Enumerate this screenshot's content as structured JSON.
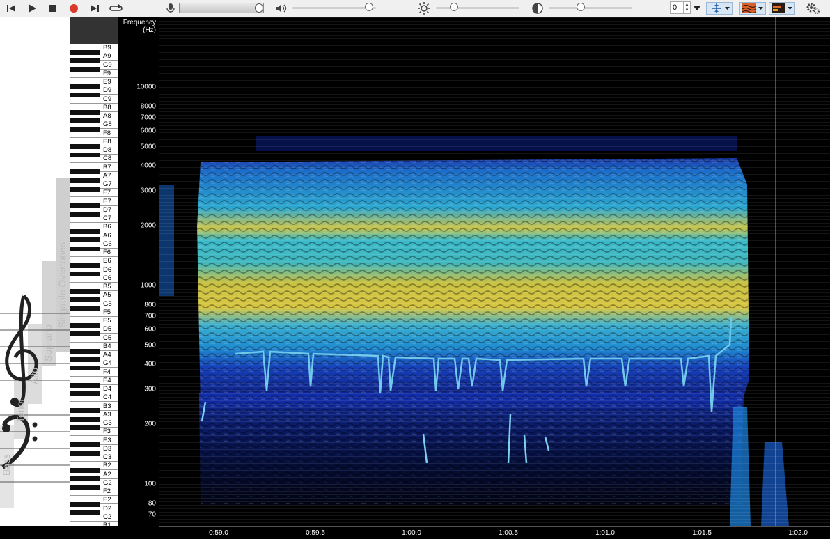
{
  "toolbar": {
    "spin_value": "0"
  },
  "voices": {
    "bass": "Bass",
    "tenor": "Tenor",
    "alto": "Alto",
    "soprano": "Soprano",
    "overtones": "Singable Overtones"
  },
  "freq_axis": {
    "title_line1": "Frequency",
    "title_line2": "(Hz)",
    "ticks": [
      "10000",
      "8000",
      "7000",
      "6000",
      "5000",
      "4000",
      "3000",
      "2000",
      "1000",
      "800",
      "700",
      "600",
      "500",
      "400",
      "300",
      "200",
      "100",
      "80",
      "70"
    ]
  },
  "time_axis": {
    "ticks": [
      "0:59.0",
      "0:59.5",
      "1:00.0",
      "1:00.5",
      "1:01.0",
      "1:01.5",
      "1:02.0"
    ]
  },
  "notes": [
    "B9",
    "A9",
    "G9",
    "F9",
    "E9",
    "D9",
    "C9",
    "B8",
    "A8",
    "G8",
    "F8",
    "E8",
    "D8",
    "C8",
    "B7",
    "A7",
    "G7",
    "F7",
    "E7",
    "D7",
    "C7",
    "B6",
    "A6",
    "G6",
    "F6",
    "E6",
    "D6",
    "C6",
    "B5",
    "A5",
    "G5",
    "F5",
    "E5",
    "D5",
    "C5",
    "B4",
    "A4",
    "G4",
    "F4",
    "E4",
    "D4",
    "C4",
    "B3",
    "A3",
    "G3",
    "F3",
    "E3",
    "D3",
    "C3",
    "B2",
    "A2",
    "G2",
    "F2",
    "E2",
    "D2",
    "C2",
    "B1"
  ],
  "colors": {
    "accent_record": "#d93a2b",
    "spectrum_low": "#0b1a8c",
    "spectrum_mid": "#2bb7d6",
    "spectrum_high": "#e6c73a",
    "playhead": "#3fd26a"
  }
}
